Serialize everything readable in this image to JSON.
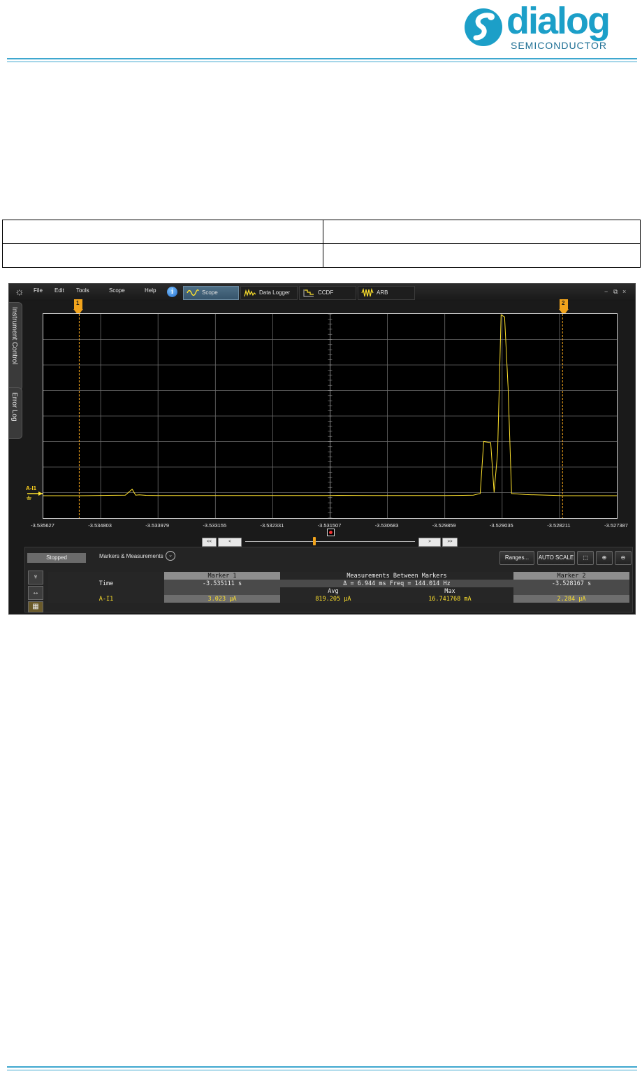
{
  "header": {
    "logo_word": "dialog",
    "logo_sub": "SEMICONDUCTOR"
  },
  "app": {
    "menu": [
      "File",
      "Edit",
      "Tools",
      "Scope",
      "Help"
    ],
    "tabs": [
      {
        "label": "Scope",
        "icon": "sine-wave-icon",
        "active": true
      },
      {
        "label": "Data Logger",
        "icon": "data-logger-icon",
        "active": false
      },
      {
        "label": "CCDF",
        "icon": "ccdf-icon",
        "active": false
      },
      {
        "label": "ARB",
        "icon": "arb-wave-icon",
        "active": false
      }
    ],
    "window_controls": [
      "−",
      "⧉",
      "×"
    ],
    "side_tabs": [
      "Instrument Control",
      "Error Log"
    ],
    "trace_label": "A-I1",
    "x_ticks": [
      "-3.535627",
      "-3.534803",
      "-3.533979",
      "-3.533155",
      "-3.532331",
      "-3.531507",
      "-3.530683",
      "-3.529859",
      "-3.529035",
      "-3.528211",
      "-3.527387"
    ],
    "marker1_num": "1",
    "marker2_num": "2",
    "nav_buttons": [
      "<<",
      "<",
      ">",
      ">>"
    ],
    "status": "Stopped",
    "markers_label": "Markers & Measurements",
    "ranges_button": "Ranges...",
    "autoscale_button": "AUTO SCALE",
    "measurements": {
      "marker1_header": "Marker 1",
      "between_header": "Measurements Between Markers",
      "marker2_header": "Marker 2",
      "time_label": "Time",
      "marker1_time": "-3.535111 s",
      "delta": "Δ = 6.944 ms   Freq = 144.014 Hz",
      "marker2_time": "-3.528167 s",
      "avg_header": "Avg",
      "max_header": "Max",
      "channel": "A-I1",
      "marker1_value": "3.023 μA",
      "avg_value": "819.205 μA",
      "max_value": "16.741768 mA",
      "marker2_value": "2.284 μA"
    },
    "colors": {
      "trace": "#ffe22d",
      "marker": "#f2a41c",
      "accent": "#1c9fc8"
    }
  },
  "chart_data": {
    "type": "line",
    "title": "",
    "xlabel": "",
    "ylabel": "",
    "xlim": [
      -3.535627,
      -3.527387
    ],
    "x_ticks": [
      -3.535627,
      -3.534803,
      -3.533979,
      -3.533155,
      -3.532331,
      -3.531507,
      -3.530683,
      -3.529859,
      -3.529035,
      -3.528211,
      -3.527387
    ],
    "grid": true,
    "series": [
      {
        "name": "A-I1",
        "x": [
          -3.535627,
          -3.535111,
          -3.5347,
          -3.53445,
          -3.53435,
          -3.5343,
          -3.53425,
          -3.53415,
          -3.533979,
          -3.533155,
          -3.532331,
          -3.531507,
          -3.5314,
          -3.5309,
          -3.530683,
          -3.529859,
          -3.5296,
          -3.52945,
          -3.52935,
          -3.5293,
          -3.5292,
          -3.52915,
          -3.5291,
          -3.52905,
          -3.529,
          -3.52895,
          -3.5289,
          -3.5287,
          -3.528211,
          -3.528167,
          -3.527387
        ],
        "values": [
          0.003,
          0.003,
          0.03,
          0.05,
          0.6,
          0.05,
          0.08,
          0.03,
          0.01,
          0.01,
          0.01,
          0.01,
          0.03,
          0.01,
          0.01,
          0.01,
          0.03,
          0.05,
          0.2,
          5.0,
          4.9,
          0.3,
          4.0,
          16.7,
          16.5,
          10.0,
          0.2,
          0.1,
          0.01,
          0.002,
          0.002
        ]
      }
    ],
    "markers": [
      {
        "name": "Marker 1",
        "x": -3.535111
      },
      {
        "name": "Marker 2",
        "x": -3.528167
      }
    ]
  }
}
